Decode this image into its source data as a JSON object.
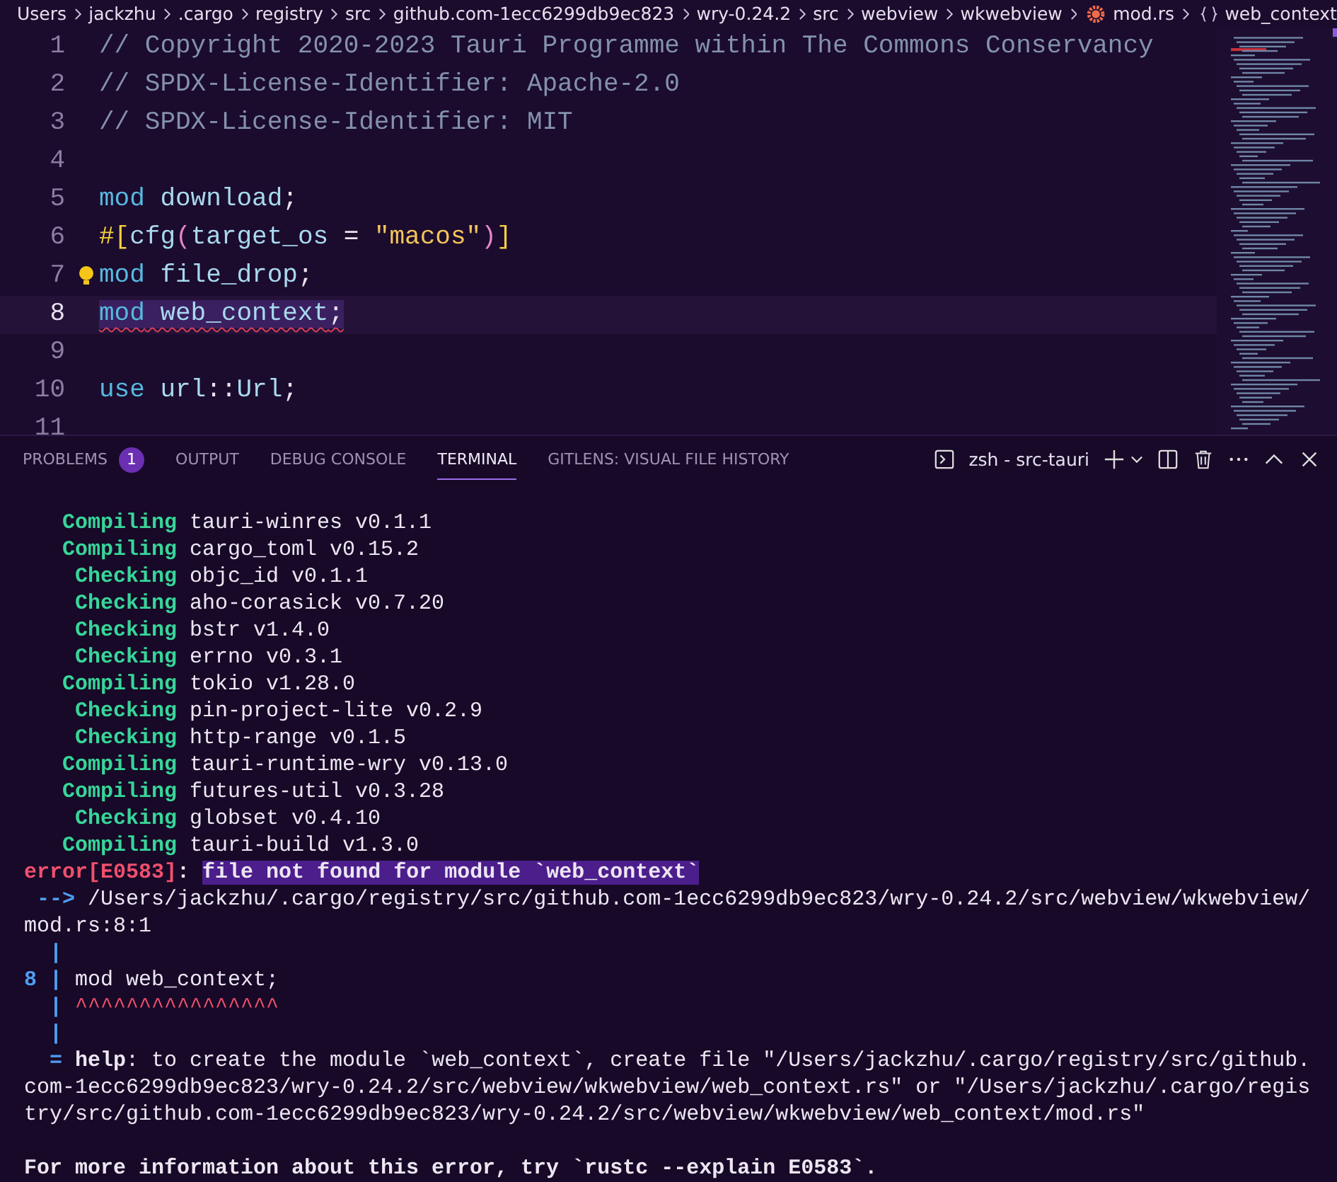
{
  "breadcrumb": [
    {
      "label": "Users",
      "kind": "folder"
    },
    {
      "label": "jackzhu",
      "kind": "folder"
    },
    {
      "label": ".cargo",
      "kind": "folder"
    },
    {
      "label": "registry",
      "kind": "folder"
    },
    {
      "label": "src",
      "kind": "folder"
    },
    {
      "label": "github.com-1ecc6299db9ec823",
      "kind": "folder"
    },
    {
      "label": "wry-0.24.2",
      "kind": "folder"
    },
    {
      "label": "src",
      "kind": "folder"
    },
    {
      "label": "webview",
      "kind": "folder"
    },
    {
      "label": "wkwebview",
      "kind": "folder"
    },
    {
      "label": "mod.rs",
      "kind": "file"
    },
    {
      "label": "web_context",
      "kind": "symbol"
    }
  ],
  "editor": {
    "lines": [
      {
        "number": "1",
        "current": false,
        "lightbulb": false,
        "squiggle": false,
        "tokens": [
          {
            "text": "// Copyright 2020-2023 Tauri Programme within The Commons Conservancy",
            "kind": "comment"
          }
        ]
      },
      {
        "number": "2",
        "current": false,
        "lightbulb": false,
        "squiggle": false,
        "tokens": [
          {
            "text": "// SPDX-License-Identifier: Apache-2.0",
            "kind": "comment"
          }
        ]
      },
      {
        "number": "3",
        "current": false,
        "lightbulb": false,
        "squiggle": false,
        "tokens": [
          {
            "text": "// SPDX-License-Identifier: MIT",
            "kind": "comment"
          }
        ]
      },
      {
        "number": "4",
        "current": false,
        "lightbulb": false,
        "squiggle": false
      },
      {
        "number": "5",
        "current": false,
        "lightbulb": false,
        "squiggle": false,
        "tokens": [
          {
            "text": "mod",
            "kind": "keyword"
          },
          {
            "text": " download",
            "kind": "ident"
          },
          {
            "text": ";",
            "kind": "punct"
          }
        ]
      },
      {
        "number": "6",
        "current": false,
        "lightbulb": false,
        "squiggle": false,
        "tokens": [
          {
            "text": "#[",
            "kind": "attr"
          },
          {
            "text": "cfg",
            "kind": "ident"
          },
          {
            "text": "(",
            "kind": "paren"
          },
          {
            "text": "target_os",
            "kind": "ident"
          },
          {
            "text": " = ",
            "kind": "punct"
          },
          {
            "text": "\"macos\"",
            "kind": "string"
          },
          {
            "text": ")",
            "kind": "paren"
          },
          {
            "text": "]",
            "kind": "attr"
          }
        ]
      },
      {
        "number": "7",
        "current": false,
        "lightbulb": true,
        "squiggle": false,
        "tokens": [
          {
            "text": "mod",
            "kind": "keyword"
          },
          {
            "text": " file_drop",
            "kind": "ident"
          },
          {
            "text": ";",
            "kind": "punct"
          }
        ]
      },
      {
        "number": "8",
        "current": true,
        "lightbulb": false,
        "squiggle": true,
        "tokens": [
          {
            "text": "mod",
            "kind": "keyword"
          },
          {
            "text": " web_context",
            "kind": "ident"
          },
          {
            "text": ";",
            "kind": "punct"
          }
        ]
      },
      {
        "number": "9",
        "current": false,
        "lightbulb": false,
        "squiggle": false
      },
      {
        "number": "10",
        "current": false,
        "lightbulb": false,
        "squiggle": false,
        "tokens": [
          {
            "text": "use",
            "kind": "keyword"
          },
          {
            "text": " url",
            "kind": "ident"
          },
          {
            "text": "::",
            "kind": "punct"
          },
          {
            "text": "Url",
            "kind": "ident"
          },
          {
            "text": ";",
            "kind": "punct"
          }
        ]
      },
      {
        "number": "11",
        "current": false,
        "lightbulb": false,
        "squiggle": false
      }
    ]
  },
  "panel": {
    "tabs": [
      {
        "label": "PROBLEMS",
        "badge": "1",
        "selected": false
      },
      {
        "label": "OUTPUT",
        "selected": false
      },
      {
        "label": "DEBUG CONSOLE",
        "selected": false
      },
      {
        "label": "TERMINAL",
        "selected": true
      },
      {
        "label": "GITLENS: VISUAL FILE HISTORY",
        "selected": false
      }
    ],
    "terminal_name": "zsh - src-tauri"
  },
  "terminal": {
    "lines": [
      {
        "segments": [
          {
            "text": "Compiling",
            "kind": "verb"
          },
          {
            "text": " tauri-winres v0.1.1",
            "kind": "plain"
          }
        ]
      },
      {
        "segments": [
          {
            "text": "Compiling",
            "kind": "verb"
          },
          {
            "text": " cargo_toml v0.15.2",
            "kind": "plain"
          }
        ]
      },
      {
        "segments": [
          {
            "text": "Checking",
            "kind": "verb"
          },
          {
            "text": " objc_id v0.1.1",
            "kind": "plain"
          }
        ]
      },
      {
        "segments": [
          {
            "text": "Checking",
            "kind": "verb"
          },
          {
            "text": " aho-corasick v0.7.20",
            "kind": "plain"
          }
        ]
      },
      {
        "segments": [
          {
            "text": "Checking",
            "kind": "verb"
          },
          {
            "text": " bstr v1.4.0",
            "kind": "plain"
          }
        ]
      },
      {
        "segments": [
          {
            "text": "Checking",
            "kind": "verb"
          },
          {
            "text": " errno v0.3.1",
            "kind": "plain"
          }
        ]
      },
      {
        "segments": [
          {
            "text": "Compiling",
            "kind": "verb"
          },
          {
            "text": " tokio v1.28.0",
            "kind": "plain"
          }
        ]
      },
      {
        "segments": [
          {
            "text": "Checking",
            "kind": "verb"
          },
          {
            "text": " pin-project-lite v0.2.9",
            "kind": "plain"
          }
        ]
      },
      {
        "segments": [
          {
            "text": "Checking",
            "kind": "verb"
          },
          {
            "text": " http-range v0.1.5",
            "kind": "plain"
          }
        ]
      },
      {
        "segments": [
          {
            "text": "Compiling",
            "kind": "verb"
          },
          {
            "text": " tauri-runtime-wry v0.13.0",
            "kind": "plain"
          }
        ]
      },
      {
        "segments": [
          {
            "text": "Compiling",
            "kind": "verb"
          },
          {
            "text": " futures-util v0.3.28",
            "kind": "plain"
          }
        ]
      },
      {
        "segments": [
          {
            "text": "Checking",
            "kind": "verb"
          },
          {
            "text": " globset v0.4.10",
            "kind": "plain"
          }
        ]
      },
      {
        "segments": [
          {
            "text": "Compiling",
            "kind": "verb"
          },
          {
            "text": " tauri-build v1.3.0",
            "kind": "plain"
          }
        ]
      },
      {
        "segments": [
          {
            "text": "error[E0583]",
            "kind": "error"
          },
          {
            "text": ": ",
            "kind": "emphasis"
          },
          {
            "text": "file not found for module `web_context`",
            "kind": "message"
          }
        ]
      },
      {
        "segments": [
          {
            "text": " --> ",
            "kind": "gutter"
          },
          {
            "text": "/Users/jackzhu/.cargo/registry/src/github.com-1ecc6299db9ec823/wry-0.24.2/src/webview/wkwebview/",
            "kind": "plain"
          }
        ]
      },
      {
        "segments": [
          {
            "text": "mod.rs:8:1",
            "kind": "plain"
          }
        ]
      },
      {
        "segments": [
          {
            "text": "  |",
            "kind": "gutter"
          }
        ]
      },
      {
        "segments": [
          {
            "text": "8 |",
            "kind": "gutter"
          },
          {
            "text": " mod web_context;",
            "kind": "plain"
          }
        ]
      },
      {
        "segments": [
          {
            "text": "  |",
            "kind": "gutter"
          },
          {
            "text": " ^^^^^^^^^^^^^^^^",
            "kind": "underline"
          }
        ]
      },
      {
        "segments": [
          {
            "text": "  |",
            "kind": "gutter"
          }
        ]
      },
      {
        "segments": [
          {
            "text": "  =",
            "kind": "gutter"
          },
          {
            "text": " help",
            "kind": "emphasis"
          },
          {
            "text": ": to create the module `web_context`, create file \"/Users/jackzhu/.cargo/registry/src/github.",
            "kind": "plain"
          }
        ]
      },
      {
        "segments": [
          {
            "text": "com-1ecc6299db9ec823/wry-0.24.2/src/webview/wkwebview/web_context.rs\" or \"/Users/jackzhu/.cargo/regis",
            "kind": "plain"
          }
        ]
      },
      {
        "segments": [
          {
            "text": "try/src/github.com-1ecc6299db9ec823/wry-0.24.2/src/webview/wkwebview/web_context/mod.rs\"",
            "kind": "plain"
          }
        ]
      },
      {
        "kind": "blank"
      },
      {
        "segments": [
          {
            "text": "For more information about this error, try `rustc --explain E0583`.",
            "kind": "emphasis"
          }
        ]
      }
    ]
  }
}
